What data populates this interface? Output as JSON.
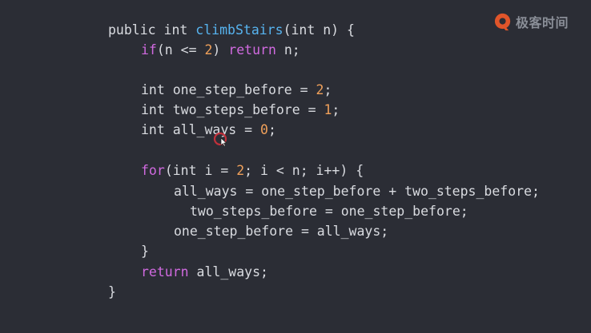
{
  "brand": {
    "logo_icon": "geekbang-logo-icon",
    "name": "极客时间",
    "accent": "#e0552a"
  },
  "colors": {
    "background": "#2b2d35",
    "text": "#d9dbe0",
    "keyword": "#d16ae0",
    "number": "#f0a05a",
    "function": "#57b4f0"
  },
  "code": {
    "language": "java",
    "lines": [
      {
        "tokens": [
          {
            "t": "public int ",
            "c": "plain"
          },
          {
            "t": "climbStairs",
            "c": "fn"
          },
          {
            "t": "(int n) {",
            "c": "plain"
          }
        ]
      },
      {
        "tokens": [
          {
            "t": "if",
            "c": "kw"
          },
          {
            "t": "(n <= ",
            "c": "plain"
          },
          {
            "t": "2",
            "c": "num"
          },
          {
            "t": ") ",
            "c": "plain"
          },
          {
            "t": "return",
            "c": "kw"
          },
          {
            "t": " n;",
            "c": "plain"
          }
        ]
      },
      {
        "tokens": []
      },
      {
        "tokens": [
          {
            "t": "int one_step_before = ",
            "c": "plain"
          },
          {
            "t": "2",
            "c": "num"
          },
          {
            "t": ";",
            "c": "plain"
          }
        ]
      },
      {
        "tokens": [
          {
            "t": "int two_steps_before = ",
            "c": "plain"
          },
          {
            "t": "1",
            "c": "num"
          },
          {
            "t": ";",
            "c": "plain"
          }
        ]
      },
      {
        "tokens": [
          {
            "t": "int all_ways = ",
            "c": "plain"
          },
          {
            "t": "0",
            "c": "num"
          },
          {
            "t": ";",
            "c": "plain"
          }
        ]
      },
      {
        "tokens": []
      },
      {
        "tokens": [
          {
            "t": "for",
            "c": "kw"
          },
          {
            "t": "(int i = ",
            "c": "plain"
          },
          {
            "t": "2",
            "c": "num"
          },
          {
            "t": "; i < n; i++) {",
            "c": "plain"
          }
        ]
      },
      {
        "tokens": [
          {
            "t": "all_ways = one_step_before + two_steps_before;",
            "c": "plain"
          }
        ]
      },
      {
        "tokens": [
          {
            "t": "two_steps_before = one_step_before;",
            "c": "plain"
          }
        ]
      },
      {
        "tokens": [
          {
            "t": "one_step_before = all_ways;",
            "c": "plain"
          }
        ]
      },
      {
        "tokens": [
          {
            "t": "}",
            "c": "plain"
          }
        ]
      },
      {
        "tokens": [
          {
            "t": "return",
            "c": "kw"
          },
          {
            "t": " all_ways;",
            "c": "plain"
          }
        ]
      },
      {
        "tokens": [
          {
            "t": "}",
            "c": "plain"
          }
        ]
      }
    ]
  },
  "cursor": {
    "icon": "mouse-pointer-icon",
    "highlight": "click-highlight"
  }
}
